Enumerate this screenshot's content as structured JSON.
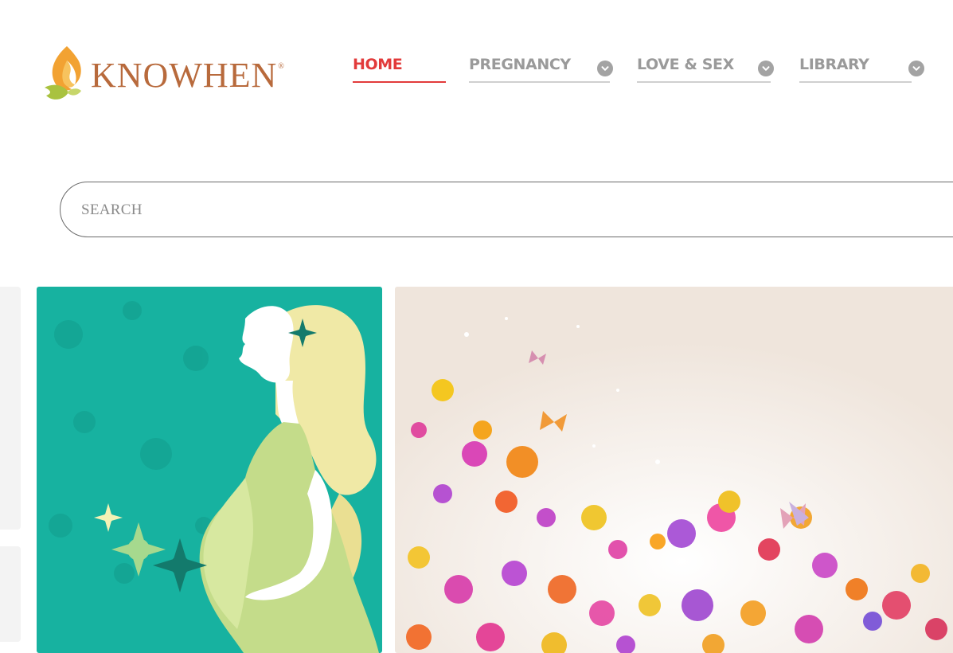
{
  "brand": {
    "name": "KNOWHEN",
    "trademark": "®",
    "colors": {
      "text": "#b86a3c",
      "flame_orange": "#f2a232",
      "leaf_green": "#a9c23f"
    }
  },
  "nav": {
    "items": [
      {
        "label": "HOME",
        "active": true,
        "has_dropdown": false
      },
      {
        "label": "PREGNANCY",
        "active": false,
        "has_dropdown": true
      },
      {
        "label": "LOVE & SEX",
        "active": false,
        "has_dropdown": true
      },
      {
        "label": "LIBRARY",
        "active": false,
        "has_dropdown": true
      }
    ],
    "active_color": "#e23b3b",
    "inactive_color": "#9a9a9a",
    "dropdown_icon": "chevron-down-icon"
  },
  "search": {
    "placeholder": "SEARCH",
    "value": ""
  },
  "cards": [
    {
      "image": "pregnant-woman-silhouette-illustration",
      "background": "#17b2a0"
    },
    {
      "image": "colorful-flowers-and-butterflies-illustration",
      "background": "#f6efe9"
    }
  ]
}
